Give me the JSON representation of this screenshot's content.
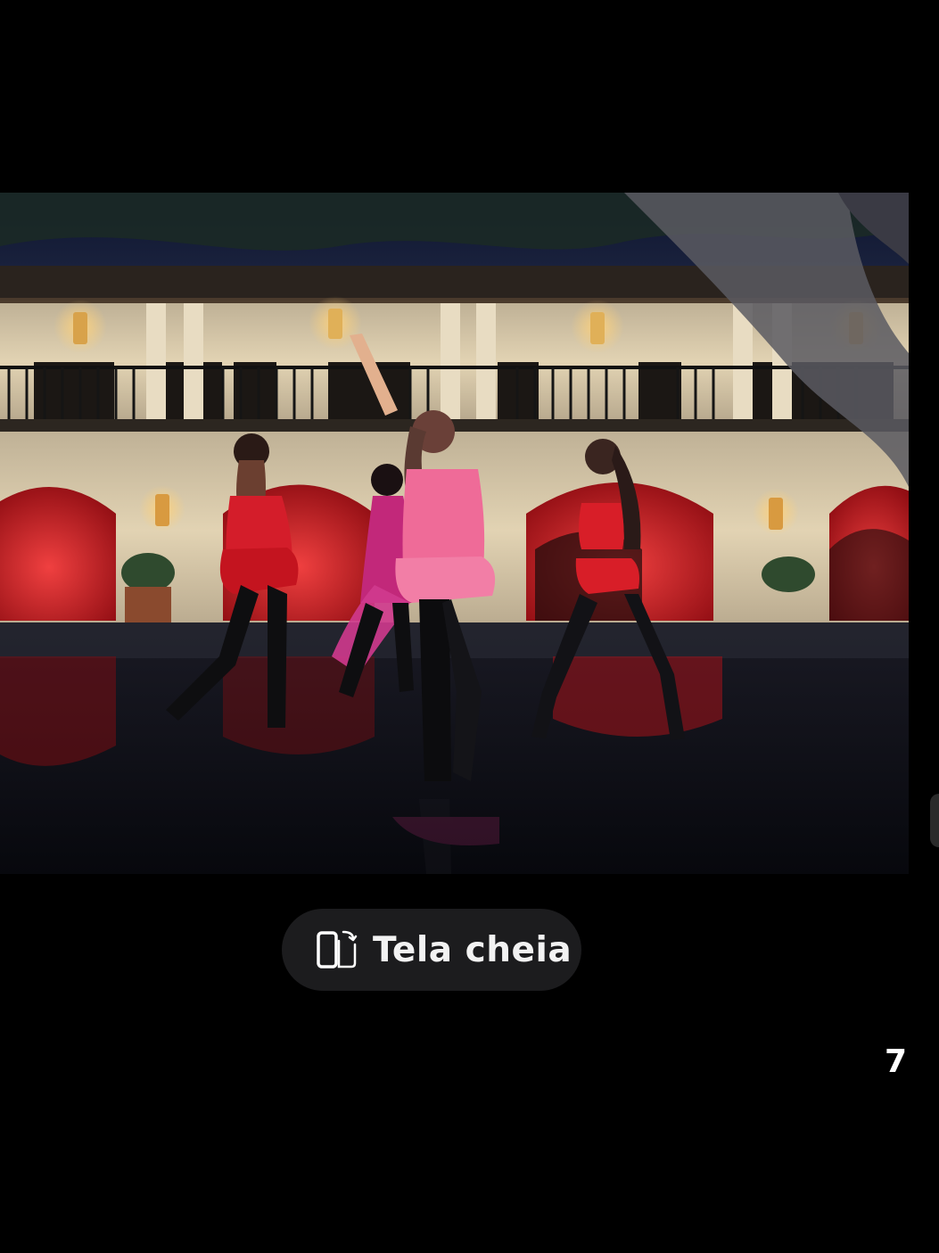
{
  "video": {
    "scene": "dance-performance",
    "colors": {
      "sky": "#121a33",
      "building": "#d9c9a8",
      "arch_red": "#c8141c",
      "floor": "#0b0d16",
      "pink_dress": "#f06a9a",
      "red_outfit": "#d81e28"
    }
  },
  "fullscreen": {
    "label": "Tela cheia",
    "icon": "rotate-phone-icon"
  },
  "page_counter": "7"
}
